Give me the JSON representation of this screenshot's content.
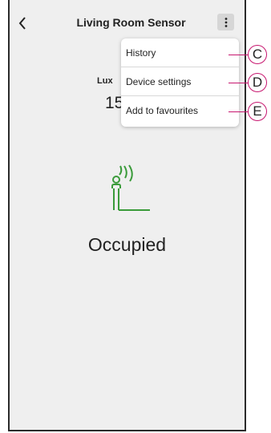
{
  "header": {
    "title": "Living Room Sensor",
    "back_icon": "chevron-left-icon",
    "more_icon": "vertical-dots-icon"
  },
  "reading": {
    "lux_label": "Lux",
    "lux_value": "15"
  },
  "menu": {
    "items": [
      {
        "label": "History"
      },
      {
        "label": "Device settings"
      },
      {
        "label": "Add to favourites"
      }
    ]
  },
  "status": {
    "icon": "occupancy-person-icon",
    "label": "Occupied",
    "icon_color": "#3a9b3a"
  },
  "callouts": [
    "C",
    "D",
    "E"
  ],
  "colors": {
    "background": "#efefef",
    "callout_accent": "#c7166f"
  }
}
